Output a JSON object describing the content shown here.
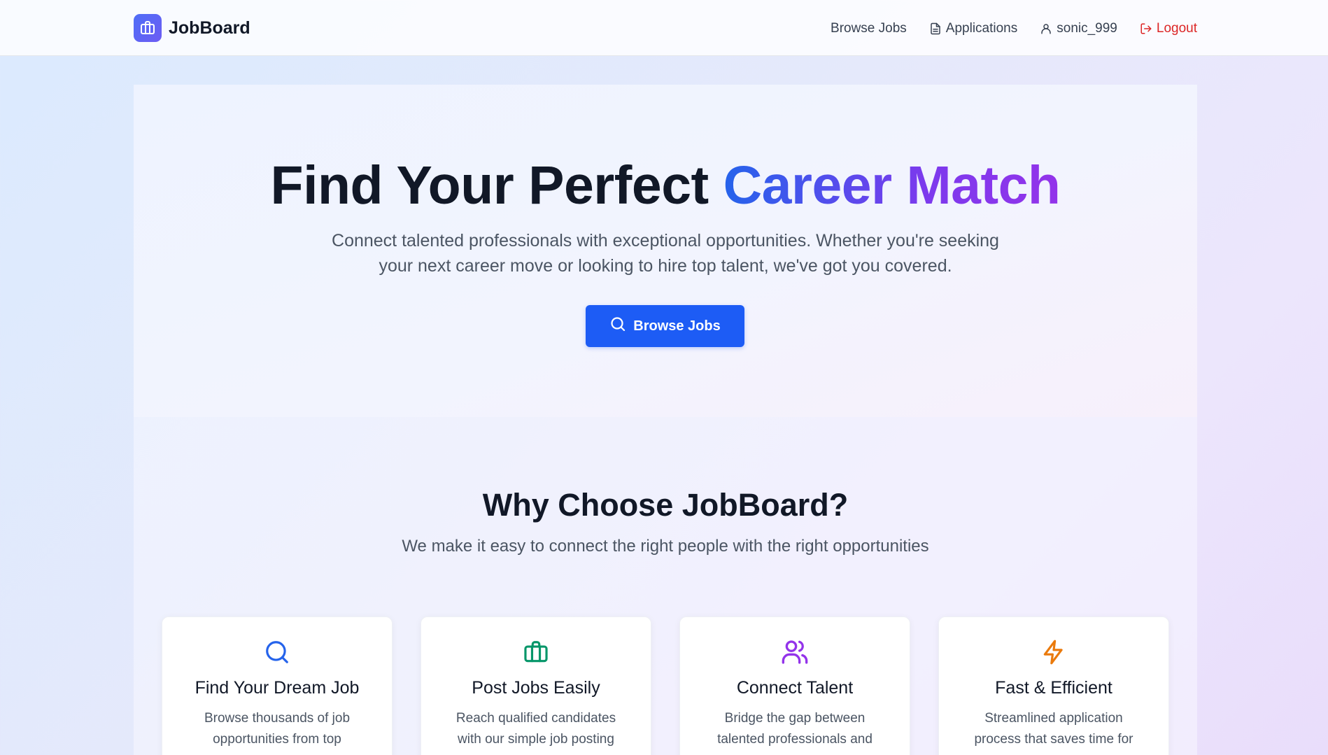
{
  "navbar": {
    "brand": "JobBoard",
    "links": {
      "browse": "Browse Jobs",
      "applications": "Applications",
      "user": "sonic_999",
      "logout": "Logout"
    }
  },
  "hero": {
    "title_main": "Find Your Perfect ",
    "title_accent": "Career Match",
    "subtitle": "Connect talented professionals with exceptional opportunities. Whether you're seeking your next career move or looking to hire top talent, we've got you covered.",
    "button_label": "Browse Jobs"
  },
  "why": {
    "title": "Why Choose JobBoard?",
    "subtitle": "We make it easy to connect the right people with the right opportunities",
    "cards": [
      {
        "icon": "search-icon",
        "color": "#2563eb",
        "title": "Find Your Dream Job",
        "desc": "Browse thousands of job opportunities from top"
      },
      {
        "icon": "briefcase-icon",
        "color": "#059669",
        "title": "Post Jobs Easily",
        "desc": "Reach qualified candidates with our simple job posting"
      },
      {
        "icon": "users-icon",
        "color": "#9333ea",
        "title": "Connect Talent",
        "desc": "Bridge the gap between talented professionals and"
      },
      {
        "icon": "lightning-icon",
        "color": "#ea7a0c",
        "title": "Fast & Efficient",
        "desc": "Streamlined application process that saves time for"
      }
    ]
  },
  "colors": {
    "primary": "#1d5cf5",
    "logout": "#dc2626",
    "accent_gradient_start": "#2563eb",
    "accent_gradient_end": "#9333ea"
  }
}
